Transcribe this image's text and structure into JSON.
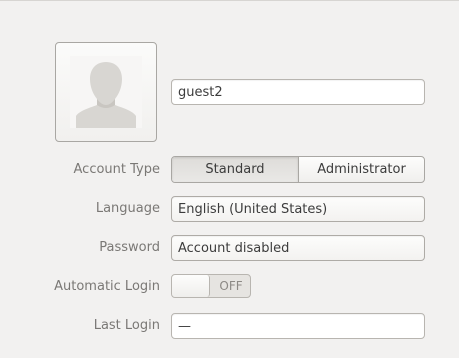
{
  "account": {
    "username": "guest2",
    "labels": {
      "account_type": "Account Type",
      "language": "Language",
      "password": "Password",
      "automatic_login": "Automatic Login",
      "last_login": "Last Login"
    },
    "account_type_options": [
      "Standard",
      "Administrator"
    ],
    "account_type_selected": "Standard",
    "language": "English (United States)",
    "password": "Account disabled",
    "automatic_login": {
      "state": "OFF"
    },
    "last_login": "—"
  },
  "icons": {
    "avatar": "user-silhouette-icon"
  },
  "colors": {
    "background": "#f2f1f0",
    "label_text": "#7a7875",
    "border": "#b8b5b0"
  }
}
